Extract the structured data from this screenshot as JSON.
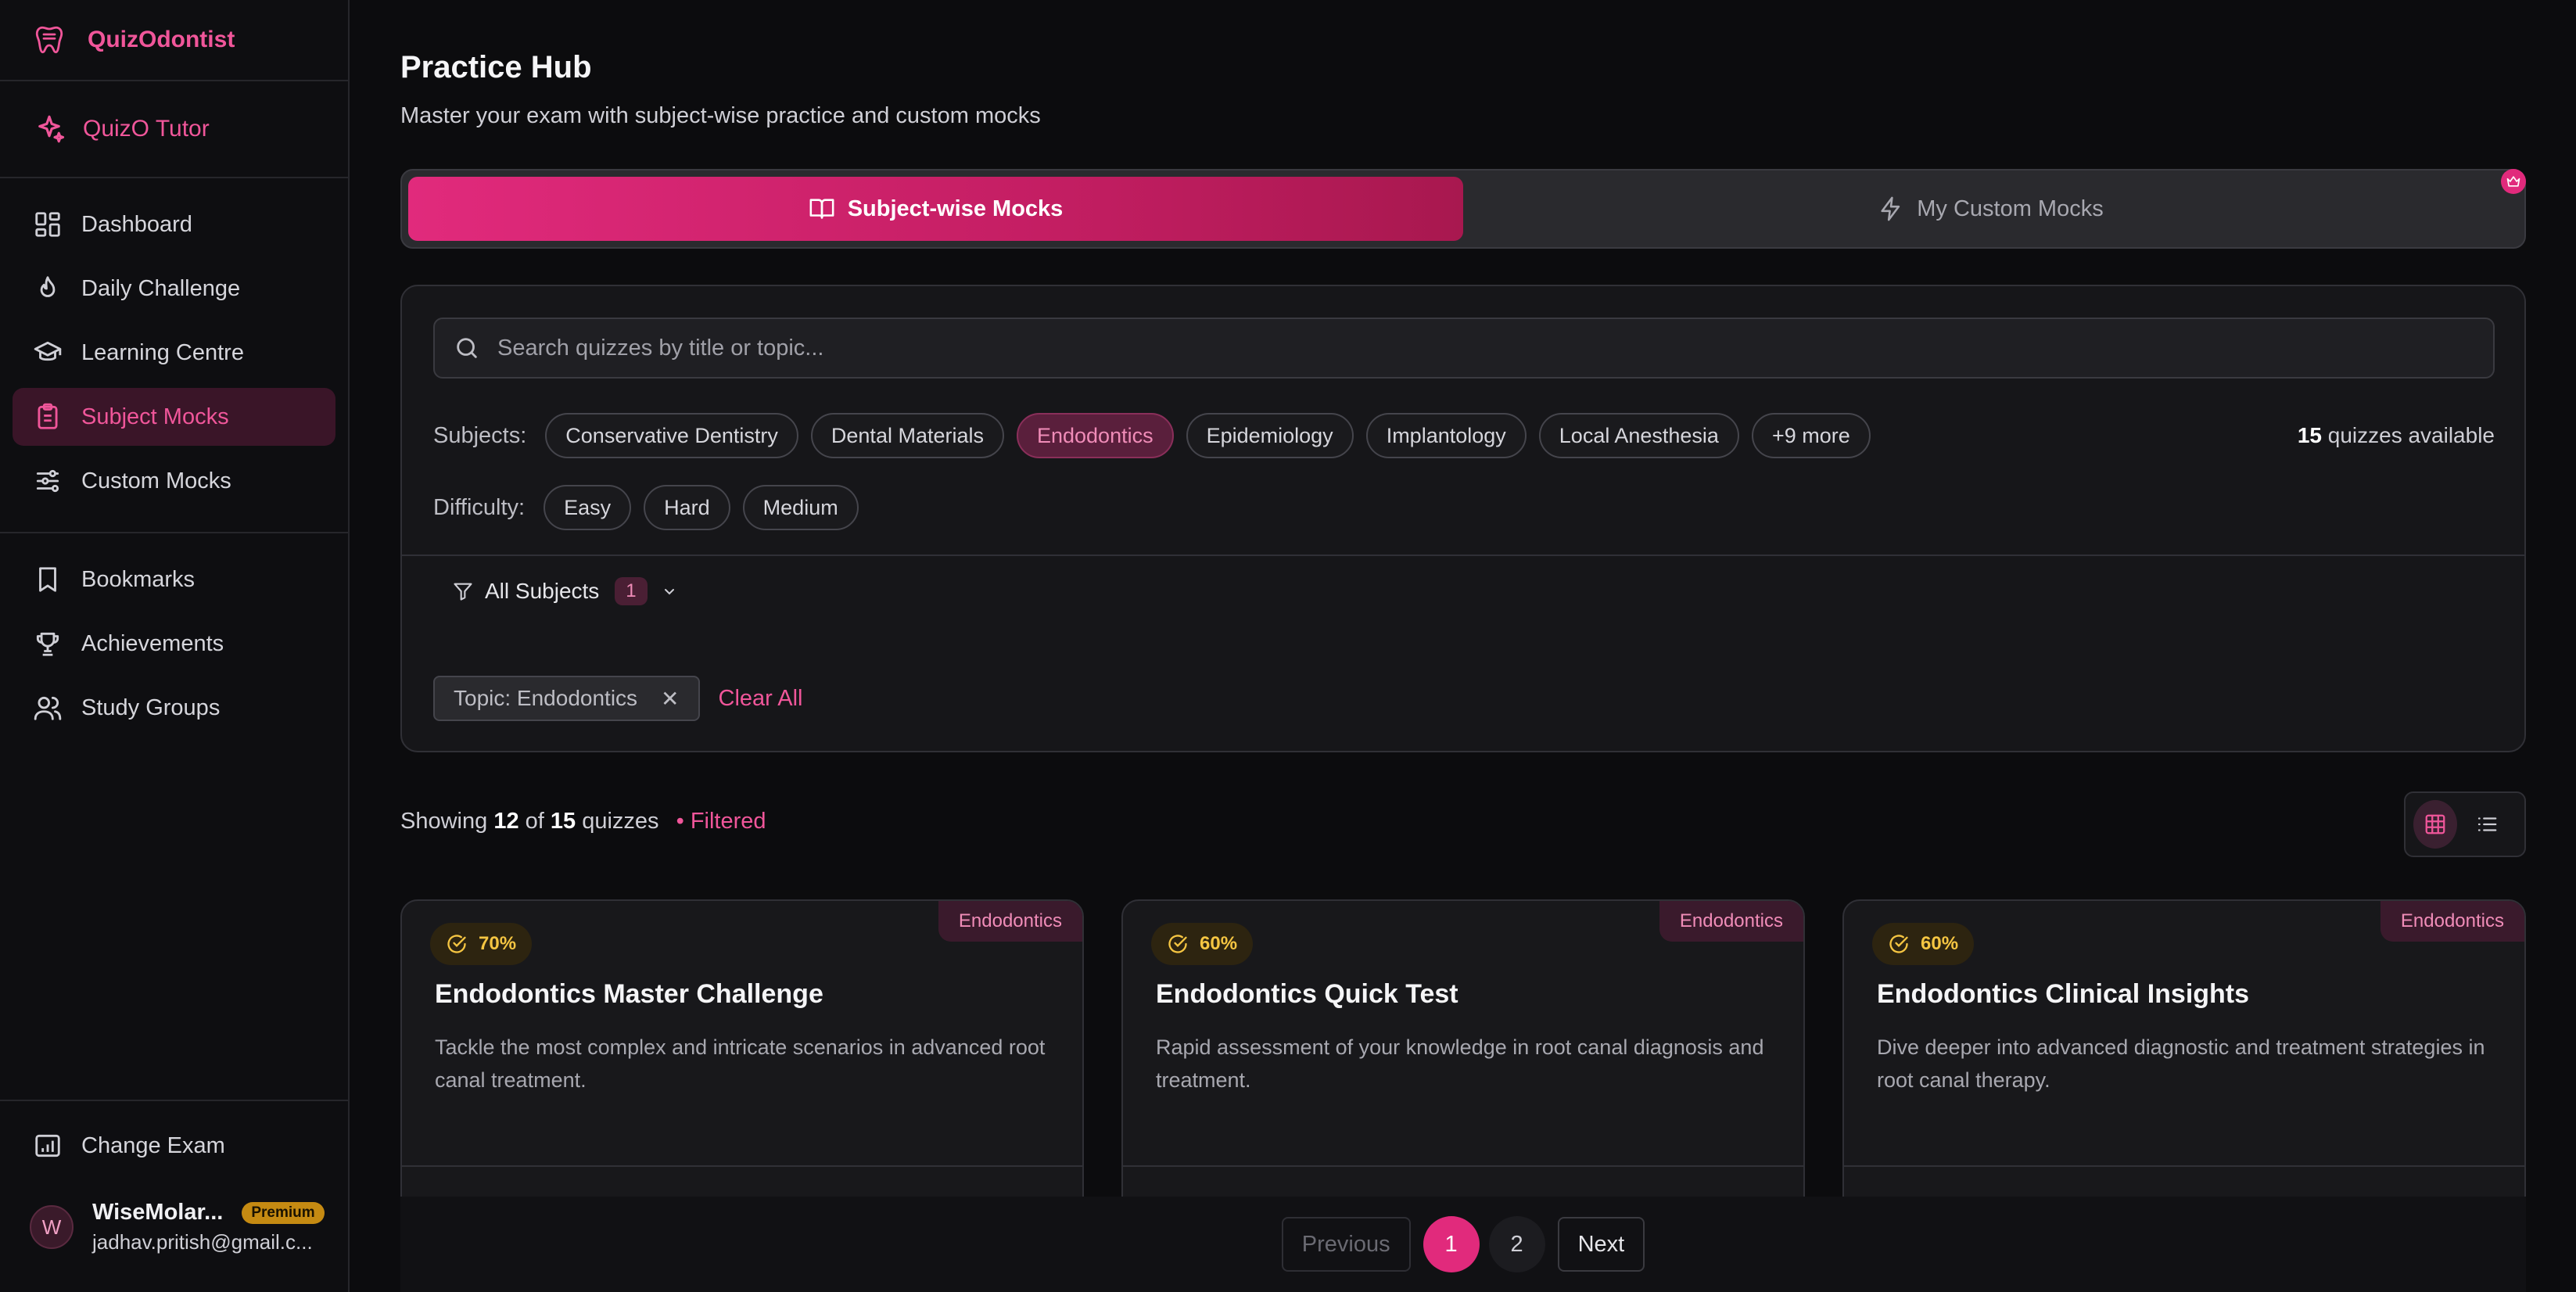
{
  "brand": {
    "name": "QuizOdontist"
  },
  "tutor": {
    "label": "QuizO Tutor"
  },
  "nav": [
    {
      "label": "Dashboard",
      "icon": "dashboard-icon"
    },
    {
      "label": "Daily Challenge",
      "icon": "flame-icon"
    },
    {
      "label": "Learning Centre",
      "icon": "graduation-cap-icon"
    },
    {
      "label": "Subject Mocks",
      "icon": "clipboard-icon",
      "active": true
    },
    {
      "label": "Custom Mocks",
      "icon": "sliders-icon"
    }
  ],
  "nav2": [
    {
      "label": "Bookmarks",
      "icon": "bookmark-icon"
    },
    {
      "label": "Achievements",
      "icon": "trophy-icon"
    },
    {
      "label": "Study Groups",
      "icon": "users-icon"
    }
  ],
  "side_bottom": {
    "change_exam": "Change Exam",
    "user_initial": "W",
    "user_name": "WiseMolar...",
    "badge": "Premium",
    "user_email": "jadhav.pritish@gmail.c..."
  },
  "page": {
    "title": "Practice Hub",
    "subtitle": "Master your exam with subject-wise practice and custom mocks"
  },
  "tabs": [
    {
      "label": "Subject-wise Mocks",
      "active": true
    },
    {
      "label": "My Custom Mocks",
      "active": false
    }
  ],
  "search": {
    "placeholder": "Search quizzes by title or topic..."
  },
  "subjects": {
    "label": "Subjects:",
    "chips": [
      "Conservative Dentistry",
      "Dental Materials",
      "Endodontics",
      "Epidemiology",
      "Implantology",
      "Local Anesthesia",
      "+9 more"
    ],
    "active_index": 2,
    "available_count": "15",
    "available_text": "quizzes available"
  },
  "difficulty": {
    "label": "Difficulty:",
    "chips": [
      "Easy",
      "Hard",
      "Medium"
    ]
  },
  "filter_dropdown": {
    "label": "All Subjects",
    "count": "1"
  },
  "active_filter": {
    "tag": "Topic: Endodontics",
    "clear": "Clear All"
  },
  "showing": {
    "prefix": "Showing",
    "shown": "12",
    "of": "of",
    "total": "15",
    "suffix": "quizzes",
    "filtered": "• Filtered"
  },
  "cards": [
    {
      "tag": "Endodontics",
      "pct": "70%",
      "title": "Endodontics Master Challenge",
      "desc": "Tackle the most complex and intricate scenarios in advanced root canal treatment."
    },
    {
      "tag": "Endodontics",
      "pct": "60%",
      "title": "Endodontics Quick Test",
      "desc": "Rapid assessment of your knowledge in root canal diagnosis and treatment."
    },
    {
      "tag": "Endodontics",
      "pct": "60%",
      "title": "Endodontics Clinical Insights",
      "desc": "Dive deeper into advanced diagnostic and treatment strategies in root canal therapy."
    }
  ],
  "pager": {
    "prev": "Previous",
    "pages": [
      "1",
      "2"
    ],
    "current": "1",
    "next": "Next"
  },
  "colors": {
    "accent": "#e12a7c",
    "accent_text": "#f0569a",
    "background": "#0c0c0e",
    "gold": "#f5c542"
  }
}
